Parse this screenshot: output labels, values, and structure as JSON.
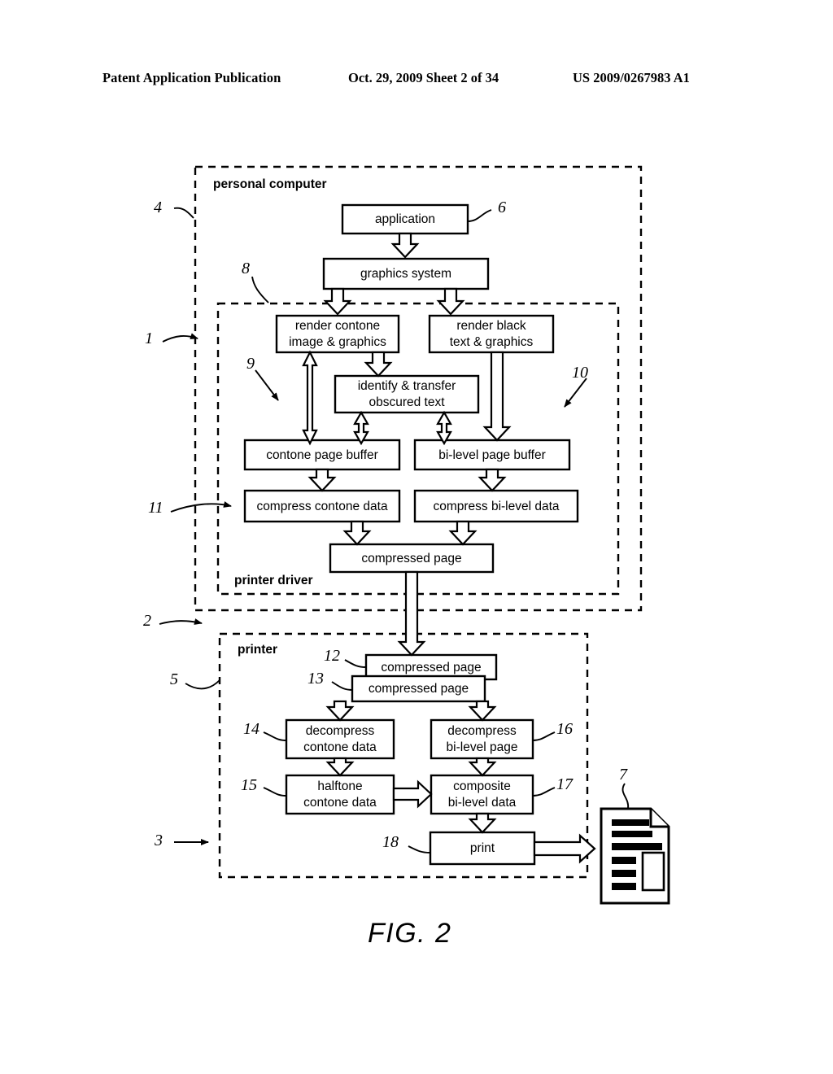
{
  "header": {
    "left": "Patent Application Publication",
    "middle": "Oct. 29, 2009  Sheet 2 of 34",
    "right": "US 2009/0267983 A1"
  },
  "figure": {
    "caption": "FIG. 2",
    "regions": [
      {
        "id": "personal-computer",
        "label": "personal computer"
      },
      {
        "id": "printer-driver",
        "label": "printer driver"
      },
      {
        "id": "printer",
        "label": "printer"
      }
    ],
    "boxes": [
      {
        "id": "application",
        "label": "application"
      },
      {
        "id": "graphics-system",
        "label": "graphics system"
      },
      {
        "id": "render-contone",
        "line1": "render contone",
        "line2": "image & graphics"
      },
      {
        "id": "render-black",
        "line1": "render black",
        "line2": "text & graphics"
      },
      {
        "id": "identify-transfer",
        "line1": "identify & transfer",
        "line2": "obscured text"
      },
      {
        "id": "contone-page-buffer",
        "label": "contone page buffer"
      },
      {
        "id": "bilevel-page-buffer",
        "label": "bi-level page buffer"
      },
      {
        "id": "compress-contone",
        "label": "compress contone data"
      },
      {
        "id": "compress-bilevel",
        "label": "compress bi-level data"
      },
      {
        "id": "compressed-page-driver",
        "label": "compressed page"
      },
      {
        "id": "compressed-page-12",
        "label": "compressed page"
      },
      {
        "id": "compressed-page-13",
        "label": "compressed page"
      },
      {
        "id": "decompress-contone",
        "line1": "decompress",
        "line2": "contone data"
      },
      {
        "id": "decompress-bilevel",
        "line1": "decompress",
        "line2": "bi-level page"
      },
      {
        "id": "halftone-contone",
        "line1": "halftone",
        "line2": "contone data"
      },
      {
        "id": "composite-bilevel",
        "line1": "composite",
        "line2": "bi-level data"
      },
      {
        "id": "print",
        "label": "print"
      }
    ],
    "reference_numerals": [
      {
        "id": "ref-4",
        "value": "4"
      },
      {
        "id": "ref-6",
        "value": "6"
      },
      {
        "id": "ref-8",
        "value": "8"
      },
      {
        "id": "ref-1",
        "value": "1"
      },
      {
        "id": "ref-9",
        "value": "9"
      },
      {
        "id": "ref-10",
        "value": "10"
      },
      {
        "id": "ref-11",
        "value": "11"
      },
      {
        "id": "ref-2",
        "value": "2"
      },
      {
        "id": "ref-5",
        "value": "5"
      },
      {
        "id": "ref-12",
        "value": "12"
      },
      {
        "id": "ref-13",
        "value": "13"
      },
      {
        "id": "ref-14",
        "value": "14"
      },
      {
        "id": "ref-16",
        "value": "16"
      },
      {
        "id": "ref-15",
        "value": "15"
      },
      {
        "id": "ref-17",
        "value": "17"
      },
      {
        "id": "ref-3",
        "value": "3"
      },
      {
        "id": "ref-18",
        "value": "18"
      },
      {
        "id": "ref-7",
        "value": "7"
      }
    ],
    "printed_page_icon": "printed-document-icon"
  }
}
